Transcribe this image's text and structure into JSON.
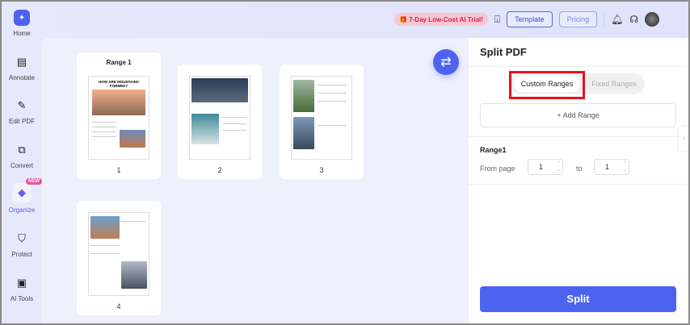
{
  "sidebar": {
    "items": [
      {
        "label": "Home",
        "icon": "home-logo-icon"
      },
      {
        "label": "Annotate",
        "icon": "annotate-icon"
      },
      {
        "label": "Edit PDF",
        "icon": "edit-icon"
      },
      {
        "label": "Convert",
        "icon": "convert-icon"
      },
      {
        "label": "Organize",
        "icon": "organize-icon",
        "badge": "NEW"
      },
      {
        "label": "Protect",
        "icon": "shield-icon"
      },
      {
        "label": "AI Tools",
        "icon": "ai-icon"
      }
    ]
  },
  "topbar": {
    "trial": "7-Day Low-Cost AI Trial!",
    "template": "Template",
    "pricing": "Pricing"
  },
  "pages": {
    "range_label": "Range 1",
    "page1_heading": "HOW ARE MOUNTAINS FORMED?",
    "numbers": [
      "1",
      "2",
      "3",
      "4"
    ]
  },
  "panel": {
    "title": "Split PDF",
    "tabs": [
      "Custom Ranges",
      "Fixed Ranges"
    ],
    "add_range": "+ Add Range",
    "range_title": "Range1",
    "from_label": "From page",
    "from_value": "1",
    "to_label": "to",
    "to_value": "1",
    "split": "Split"
  }
}
